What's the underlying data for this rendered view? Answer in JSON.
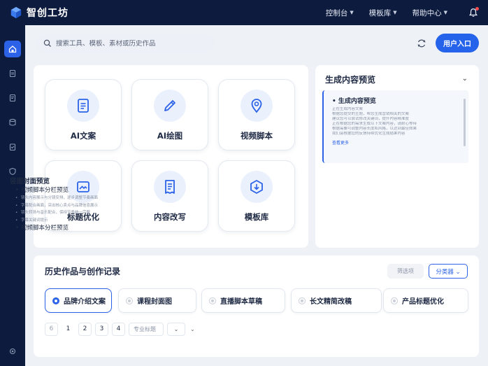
{
  "app": {
    "title": "智创工坊"
  },
  "topnav": [
    {
      "label": "控制台"
    },
    {
      "label": "模板库"
    },
    {
      "label": "帮助中心"
    }
  ],
  "search": {
    "placeholder": "搜索工具、模板、素材或历史作品"
  },
  "header": {
    "primary_button": "用户入口"
  },
  "tools": [
    {
      "label": "AI文案",
      "icon": "document-icon"
    },
    {
      "label": "AI绘图",
      "icon": "pencil-icon"
    },
    {
      "label": "视频脚本",
      "icon": "location-pin-icon"
    },
    {
      "label": "标题优化",
      "icon": "image-icon"
    },
    {
      "label": "内容改写",
      "icon": "receipt-icon"
    },
    {
      "label": "模板库",
      "icon": "download-box-icon"
    }
  ],
  "preview": {
    "title": "生成内容预览",
    "box_heading": "生成内容预览",
    "box_lines": [
      "正在生成内容文案",
      "根据您提交的主题，帮您生成营销相关的文案",
      "建议您可以尝试修改关键词，提升内容精准度",
      "正在根据您的需求生成以下文案内容，请耐心等待",
      "根据需要可调整内容长度和风格，以达到最佳效果",
      "我们会根据您的反馈持续优化生成结果内容"
    ],
    "box_link": "查看更多",
    "cover_title": "竖图封面预览",
    "cover_items": [
      {
        "text": "视频脚本分栏预览",
        "strong": true
      },
      {
        "text": "镜头内容展示与分镜安排，逐步调整节奏画面",
        "strong": false
      },
      {
        "text": "字幕配合画面，突出核心卖点与品牌信息展示",
        "strong": false
      },
      {
        "text": "镜头转场与音乐配合，保持节奏统一完整",
        "strong": false
      },
      {
        "text": "字幕关键词提示",
        "strong": false
      },
      {
        "text": "视频脚本分栏预览",
        "strong": true
      }
    ]
  },
  "history": {
    "title": "历史作品与创作记录",
    "filter_gray": "筛选项",
    "filter_blue": "分类器",
    "chips": [
      {
        "label": "品牌介绍文案",
        "selected": true
      },
      {
        "label": "课程封面图",
        "selected": false
      },
      {
        "label": "直播脚本草稿",
        "selected": false
      },
      {
        "label": "长文精简改稿",
        "selected": false
      },
      {
        "label": "产品标题优化",
        "selected": false
      }
    ],
    "pager": {
      "prev": "6",
      "pages": [
        "1",
        "2",
        "3",
        "4"
      ],
      "select_placeholder": "专业标题"
    }
  }
}
